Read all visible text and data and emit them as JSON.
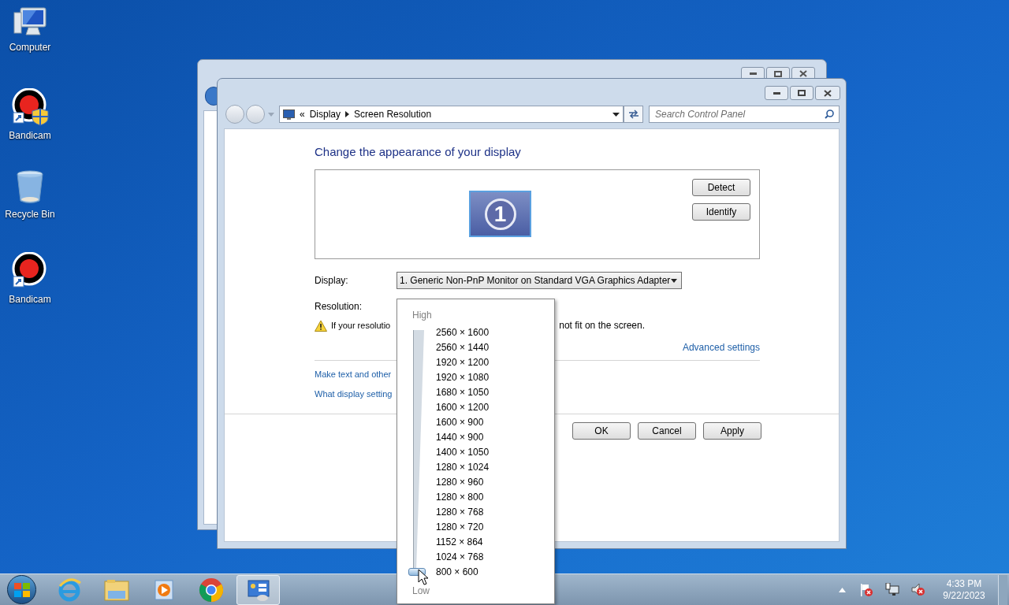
{
  "desktop_icons": [
    {
      "label": "Computer",
      "kind": "computer"
    },
    {
      "label": "Bandicam",
      "kind": "bandicam-shield"
    },
    {
      "label": "Recycle Bin",
      "kind": "recycle"
    },
    {
      "label": "Bandicam",
      "kind": "bandicam"
    }
  ],
  "window": {
    "breadcrumb_overflow": "«",
    "breadcrumb": [
      "Display",
      "Screen Resolution"
    ],
    "search": {
      "placeholder": "Search Control Panel"
    },
    "heading": "Change the appearance of your display",
    "monitor_number": "1",
    "preview_buttons": [
      "Detect",
      "Identify"
    ],
    "display_label": "Display:",
    "display_value": "1. Generic Non-PnP Monitor on Standard VGA Graphics Adapter",
    "resolution_label": "Resolution:",
    "warning": [
      "If your resolutio",
      "not fit on the screen."
    ],
    "advanced_link": "Advanced settings",
    "links": [
      "Make text and other",
      "What display setting"
    ],
    "dialog_buttons": [
      "OK",
      "Cancel",
      "Apply"
    ]
  },
  "resolution_popup": {
    "high_label": "High",
    "low_label": "Low",
    "level": 0,
    "options": [
      "2560 × 1600",
      "2560 × 1440",
      "1920 × 1200",
      "1920 × 1080",
      "1680 × 1050",
      "1600 × 1200",
      "1600 × 900",
      "1440 × 900",
      "1400 × 1050",
      "1280 × 1024",
      "1280 × 960",
      "1280 × 800",
      "1280 × 768",
      "1280 × 720",
      "1152 × 864",
      "1024 × 768",
      "800 × 600"
    ]
  },
  "taskbar": {
    "apps": [
      {
        "kind": "ie",
        "active": false
      },
      {
        "kind": "explorer",
        "active": false
      },
      {
        "kind": "media",
        "active": false
      },
      {
        "kind": "chrome",
        "active": false
      },
      {
        "kind": "control-panel",
        "active": true
      }
    ],
    "clock": {
      "time": "4:33 PM",
      "date": "9/22/2023"
    }
  }
}
